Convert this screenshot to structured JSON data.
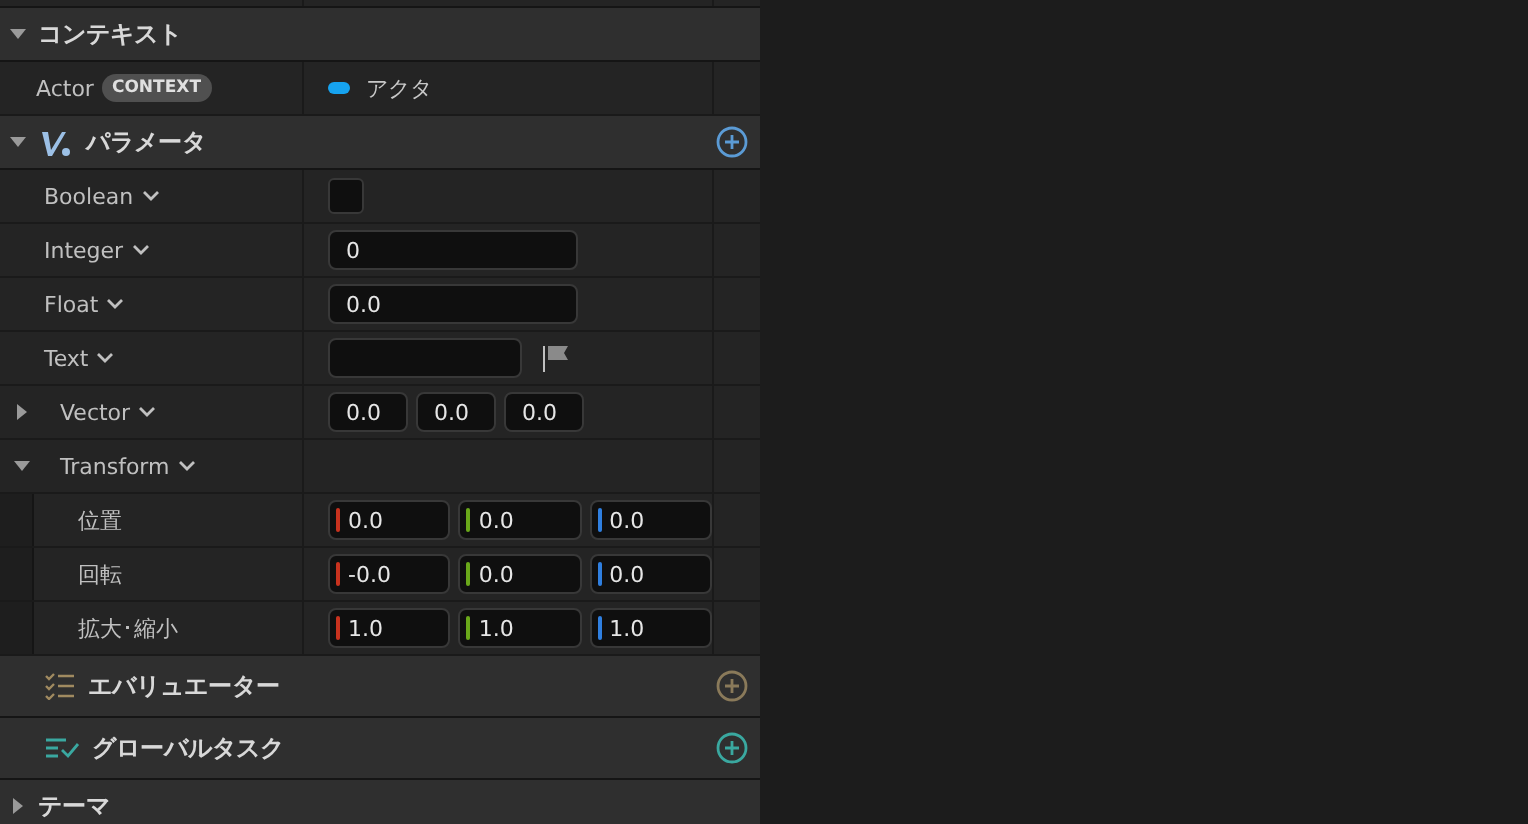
{
  "sections": [
    {
      "kind": "category",
      "title": "コンテキスト",
      "expanded": true,
      "rows": [
        {
          "kind": "context",
          "label": "Actor",
          "badge": "CONTEXT",
          "value": "アクタ"
        }
      ]
    },
    {
      "kind": "parameters",
      "title": "パラメータ",
      "expanded": true,
      "color": "#5b9bd5",
      "rows": [
        {
          "kind": "bool",
          "label": "Boolean",
          "checked": false
        },
        {
          "kind": "number",
          "label": "Integer",
          "value": "0"
        },
        {
          "kind": "number",
          "label": "Float",
          "value": "0.0"
        },
        {
          "kind": "text",
          "label": "Text"
        },
        {
          "kind": "vector",
          "label": "Vector",
          "expanded": false,
          "values": [
            "0.0",
            "0.0",
            "0.0"
          ]
        },
        {
          "kind": "group",
          "label": "Transform",
          "expanded": true,
          "children": [
            {
              "label": "位置",
              "values": [
                "0.0",
                "0.0",
                "0.0"
              ]
            },
            {
              "label": "回転",
              "values": [
                "-0.0",
                "0.0",
                "0.0"
              ]
            },
            {
              "label": "拡大･縮小",
              "values": [
                "1.0",
                "1.0",
                "1.0"
              ]
            }
          ]
        }
      ]
    },
    {
      "kind": "evaluators",
      "title": "エバリュエーター",
      "color": "#8a7a5a"
    },
    {
      "kind": "tasks",
      "title": "グローバルタスク",
      "color": "#3aa8a0"
    },
    {
      "kind": "category",
      "title": "テーマ",
      "expanded": false
    }
  ]
}
